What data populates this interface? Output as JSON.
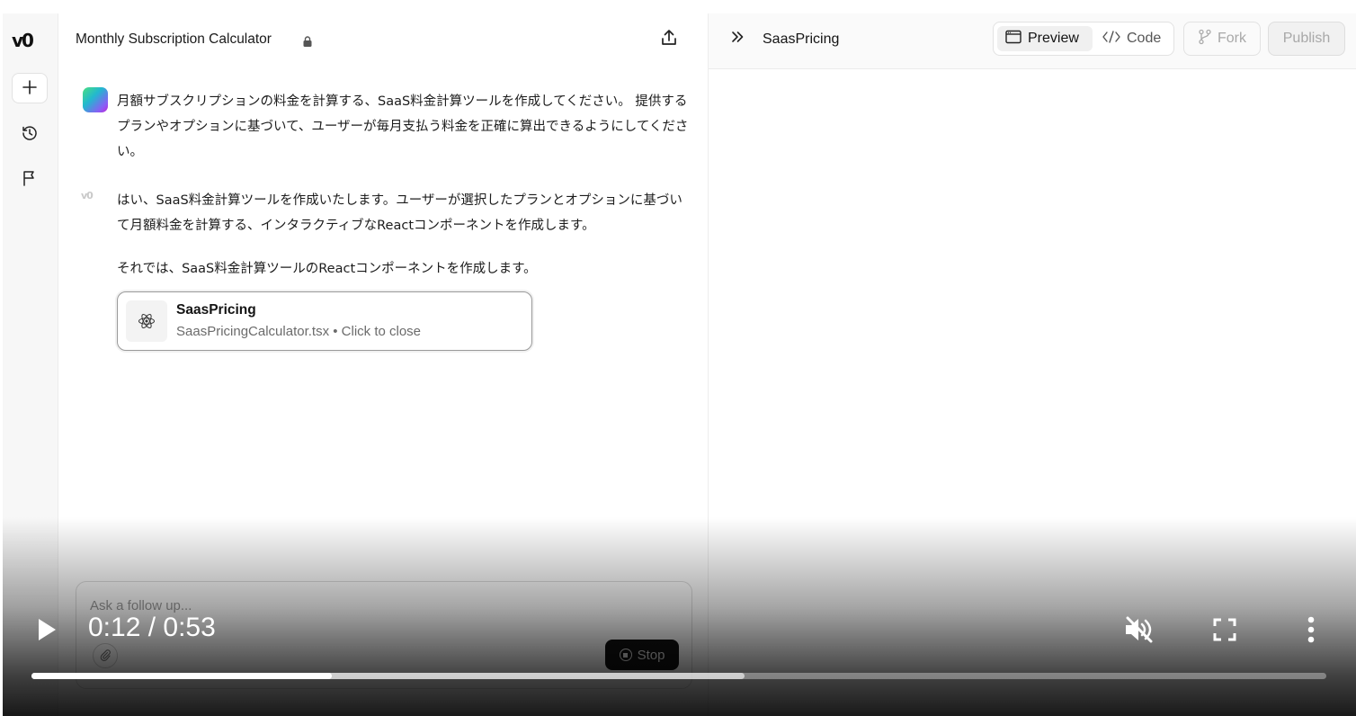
{
  "rail": {
    "logo": "v0",
    "icons": [
      "plus-icon",
      "history-icon",
      "flag-icon"
    ]
  },
  "chat": {
    "title": "Monthly Subscription Calculator",
    "messages": [
      {
        "role": "user",
        "text": "月額サブスクリプションの料金を計算する、SaaS料金計算ツールを作成してください。 提供するプランやオプションに基づいて、ユーザーが毎月支払う料金を正確に算出できるようにしてください。"
      },
      {
        "role": "assistant",
        "text": "はい、SaaS料金計算ツールを作成いたします。ユーザーが選択したプランとオプションに基づいて月額料金を計算する、インタラクティブなReactコンポーネントを作成します。"
      },
      {
        "role": "assistant",
        "text": "それでは、SaaS料金計算ツールのReactコンポーネントを作成します。"
      }
    ],
    "file_card": {
      "name": "SaasPricing",
      "subtitle": "SaasPricingCalculator.tsx • Click to close"
    },
    "composer": {
      "placeholder": "Ask a follow up...",
      "stop_label": "Stop"
    }
  },
  "preview": {
    "title": "SaasPricing",
    "tabs": [
      {
        "label": "Preview",
        "active": true
      },
      {
        "label": "Code",
        "active": false
      }
    ],
    "fork_label": "Fork",
    "publish_label": "Publish"
  },
  "video": {
    "time": "0:12 / 0:53",
    "played_fraction": 0.232,
    "buffered_fraction": 0.551,
    "muted": true
  }
}
